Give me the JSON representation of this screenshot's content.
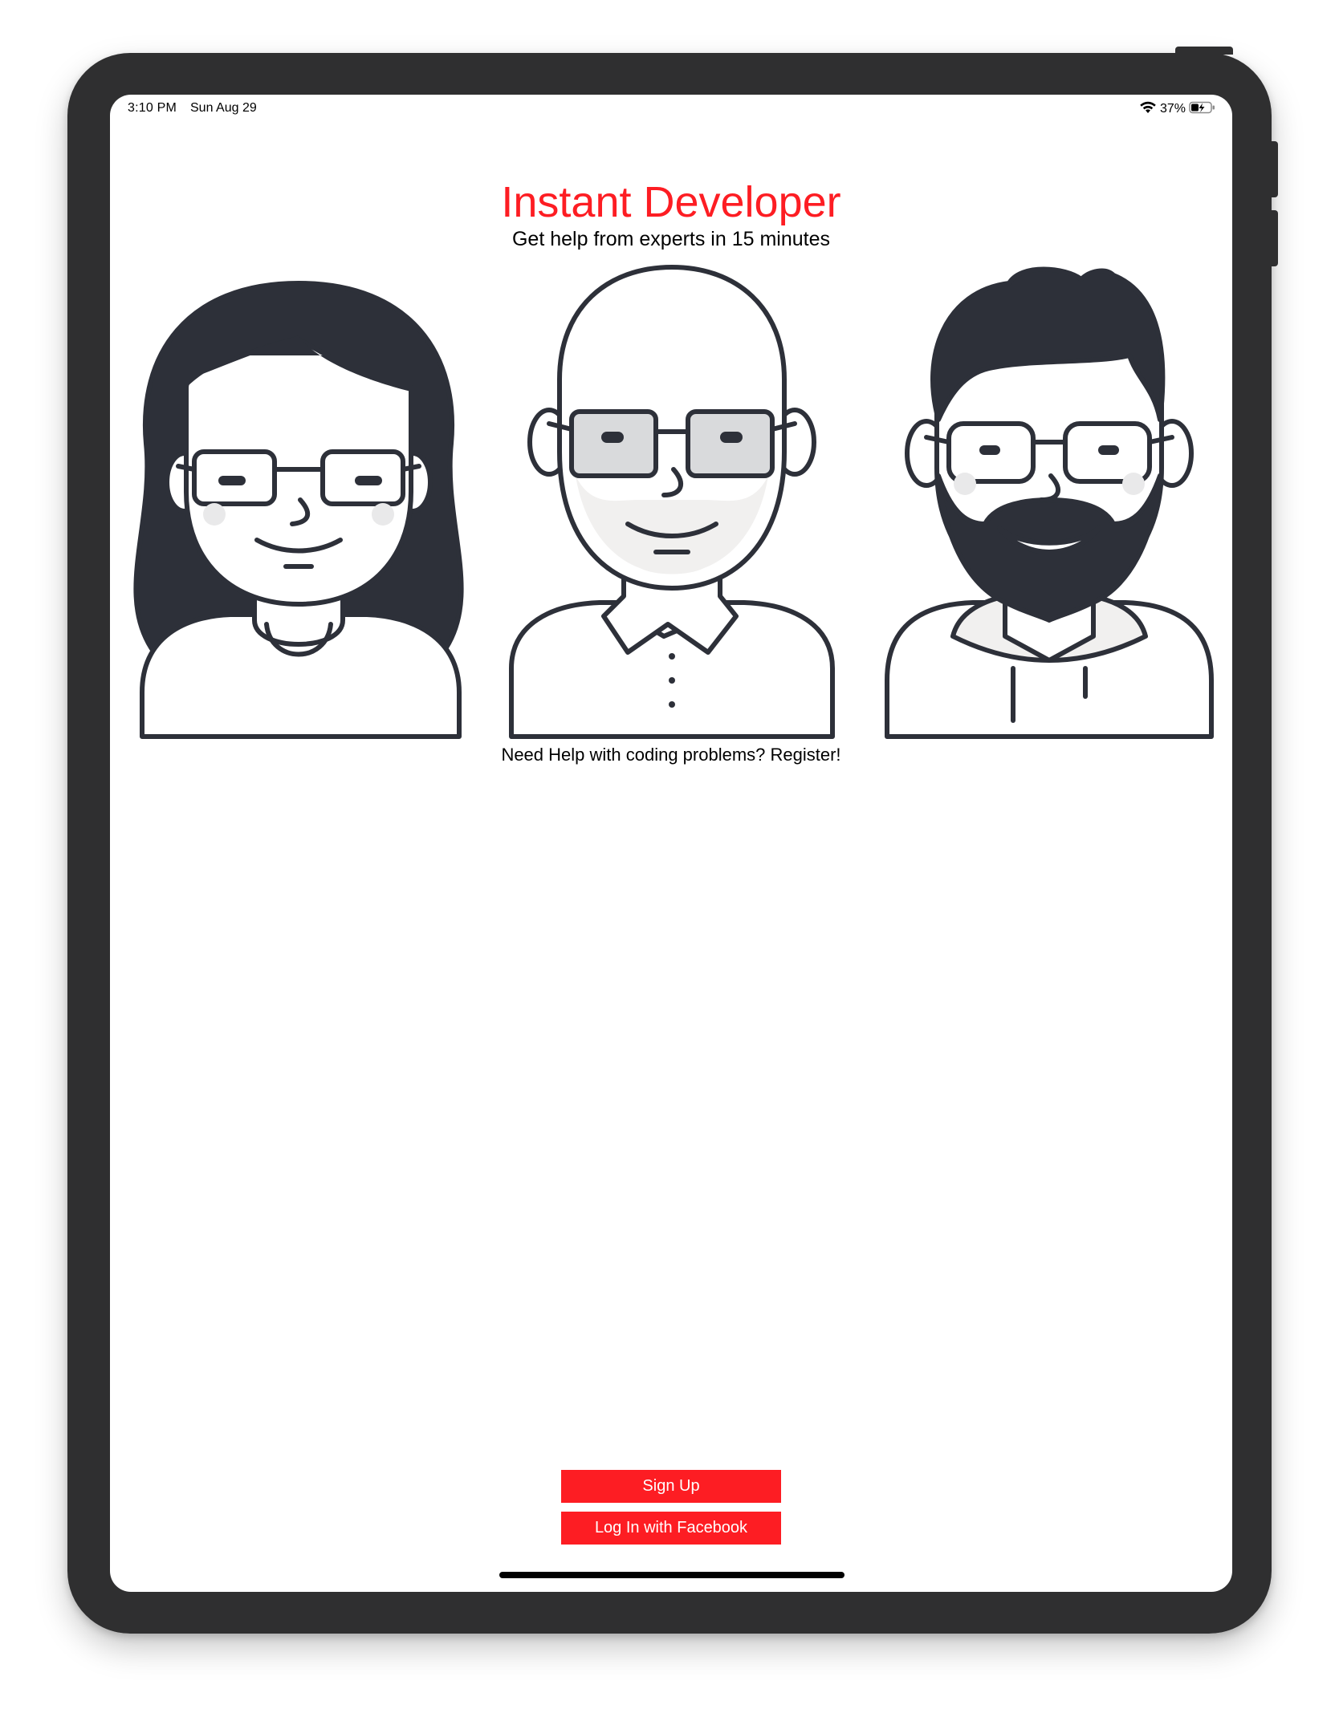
{
  "status_bar": {
    "time": "3:10 PM",
    "date": "Sun Aug 29",
    "battery_percent": "37%",
    "icons": [
      "wifi-icon",
      "battery-charging-icon"
    ]
  },
  "header": {
    "title": "Instant Developer",
    "subtitle": "Get help from experts in 15 minutes"
  },
  "illustration": {
    "avatars": [
      "woman-with-glasses-avatar",
      "bald-man-with-glasses-avatar",
      "bearded-man-with-glasses-avatar"
    ]
  },
  "register_prompt": "Need Help with coding problems? Register!",
  "actions": {
    "sign_up_label": "Sign Up",
    "facebook_login_label": "Log In with Facebook"
  },
  "colors": {
    "accent": "#fd1d23",
    "device_frame": "#2f2f30",
    "illustration_ink": "#2d3039",
    "illustration_shade": "#f1f0ef"
  }
}
